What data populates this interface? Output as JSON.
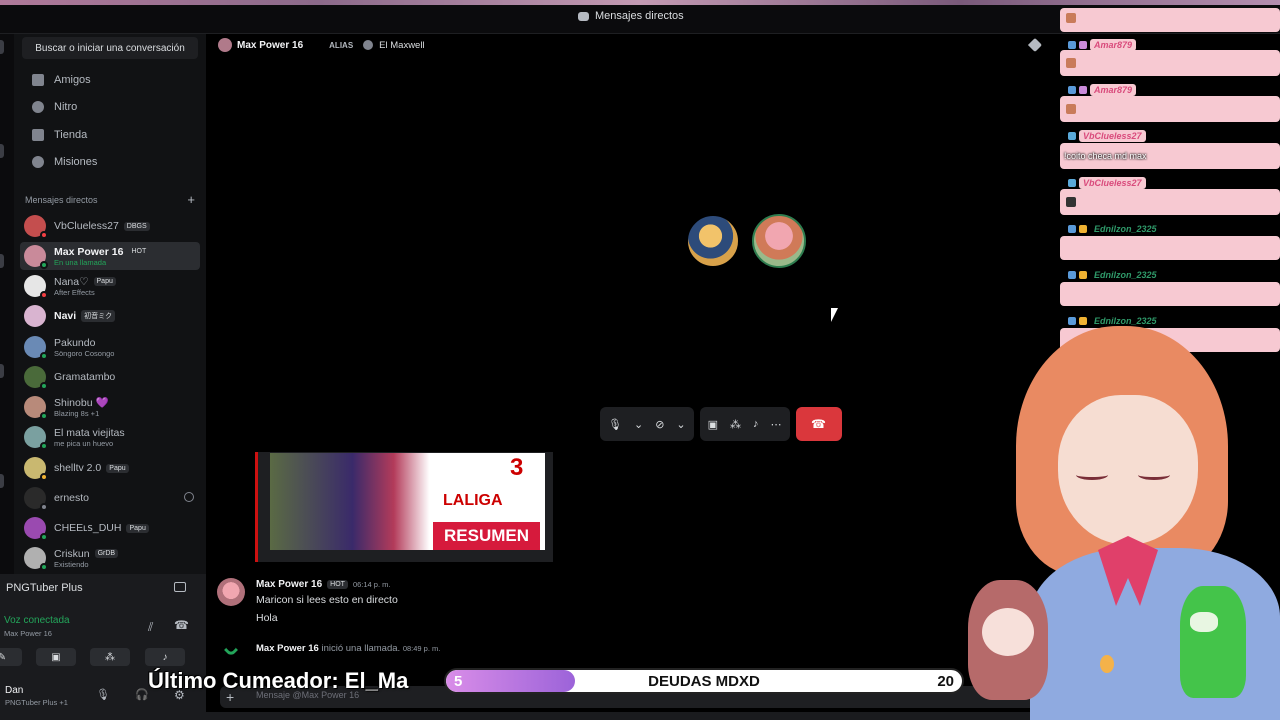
{
  "topbar": {
    "title": "Mensajes directos"
  },
  "sidebar": {
    "search_label": "Buscar o iniciar una conversación",
    "nav": [
      {
        "label": "Amigos",
        "icon": "friends-icon"
      },
      {
        "label": "Nitro",
        "icon": "nitro-icon"
      },
      {
        "label": "Tienda",
        "icon": "shop-icon"
      },
      {
        "label": "Misiones",
        "icon": "quests-icon"
      }
    ],
    "dm_header": "Mensajes directos",
    "dms": [
      {
        "name": "VbClueless27",
        "tag": "DBGS",
        "sub": "",
        "color": "#c44e4e"
      },
      {
        "name": "Max Power 16",
        "tag": "HOT",
        "sub": "En una llamada",
        "color": "#c98a9a"
      },
      {
        "name": "Nana♡",
        "tag": "Papu",
        "sub": "After Effects",
        "color": "#e6e6e6"
      },
      {
        "name": "Navi",
        "tag": "初音ミク",
        "sub": "",
        "color": "#d9b4d0"
      },
      {
        "name": "Pakundo",
        "tag": "",
        "sub": "Söngoro Cosongo",
        "color": "#6a8ab5"
      },
      {
        "name": "Gramatambo",
        "tag": "",
        "sub": "",
        "color": "#4a6a3a"
      },
      {
        "name": "Shinobu 💜",
        "tag": "",
        "sub": "Blazing 8s +1",
        "color": "#b88a7a"
      },
      {
        "name": "El mata viejitas",
        "tag": "",
        "sub": "me pica un huevo",
        "color": "#7aa0a0"
      },
      {
        "name": "shelltv 2.0",
        "tag": "Papu",
        "sub": "",
        "color": "#c9b870"
      },
      {
        "name": "ernesto",
        "tag": "",
        "sub": "",
        "color": "#2a2a2a"
      },
      {
        "name": "CHEEʟꜱ_DUH",
        "tag": "Papu",
        "sub": "",
        "color": "#9a4ab0"
      },
      {
        "name": "Criskun",
        "tag": "GrDB",
        "sub": "Existiendo",
        "color": "#b0b0b0"
      }
    ]
  },
  "panel": {
    "title": "PNGTuber Plus",
    "voice_status": "Voz conectada",
    "voice_sub": "Max Power 16",
    "user_name": "Dan",
    "user_sub": "PNGTuber Plus +1"
  },
  "dm_head": {
    "name": "Max Power 16",
    "alias_label": "ALIAS",
    "alias_value": "El Maxwell"
  },
  "embed": {
    "score": "3",
    "league": "LALIGA",
    "title": "RESUMEN"
  },
  "message": {
    "author": "Max Power 16",
    "tag": "HOT",
    "time": "06:14 p. m.",
    "lines": [
      "Maricon si lees esto en directo",
      "Hola"
    ],
    "system_author": "Max Power 16",
    "system_text": "inició una llamada.",
    "system_time": "08:49 p. m."
  },
  "composer": {
    "placeholder": "Mensaje @Max Power 16"
  },
  "stream_chat": {
    "messages": [
      {
        "user": "Amar879",
        "text": ""
      },
      {
        "user": "Amar879",
        "text": ""
      },
      {
        "user": "VbClueless27",
        "text": "!coito checa md max"
      },
      {
        "user": "VbClueless27",
        "text": ""
      },
      {
        "user": "Ednilzon_2325",
        "text": ""
      },
      {
        "user": "Ednilzon_2325",
        "text": ""
      },
      {
        "user": "Ednilzon_2325",
        "text": ""
      }
    ]
  },
  "overlay": {
    "cumeador": "Último Cumeador: El_Ma",
    "goal_start": "5",
    "goal_title": "DEUDAS MDXD",
    "goal_end": "20",
    "goal_fraction": 0.25
  },
  "colors": {
    "accent_red": "#da373c",
    "online_green": "#23a55a",
    "chat_pink": "#f7c9d2"
  }
}
